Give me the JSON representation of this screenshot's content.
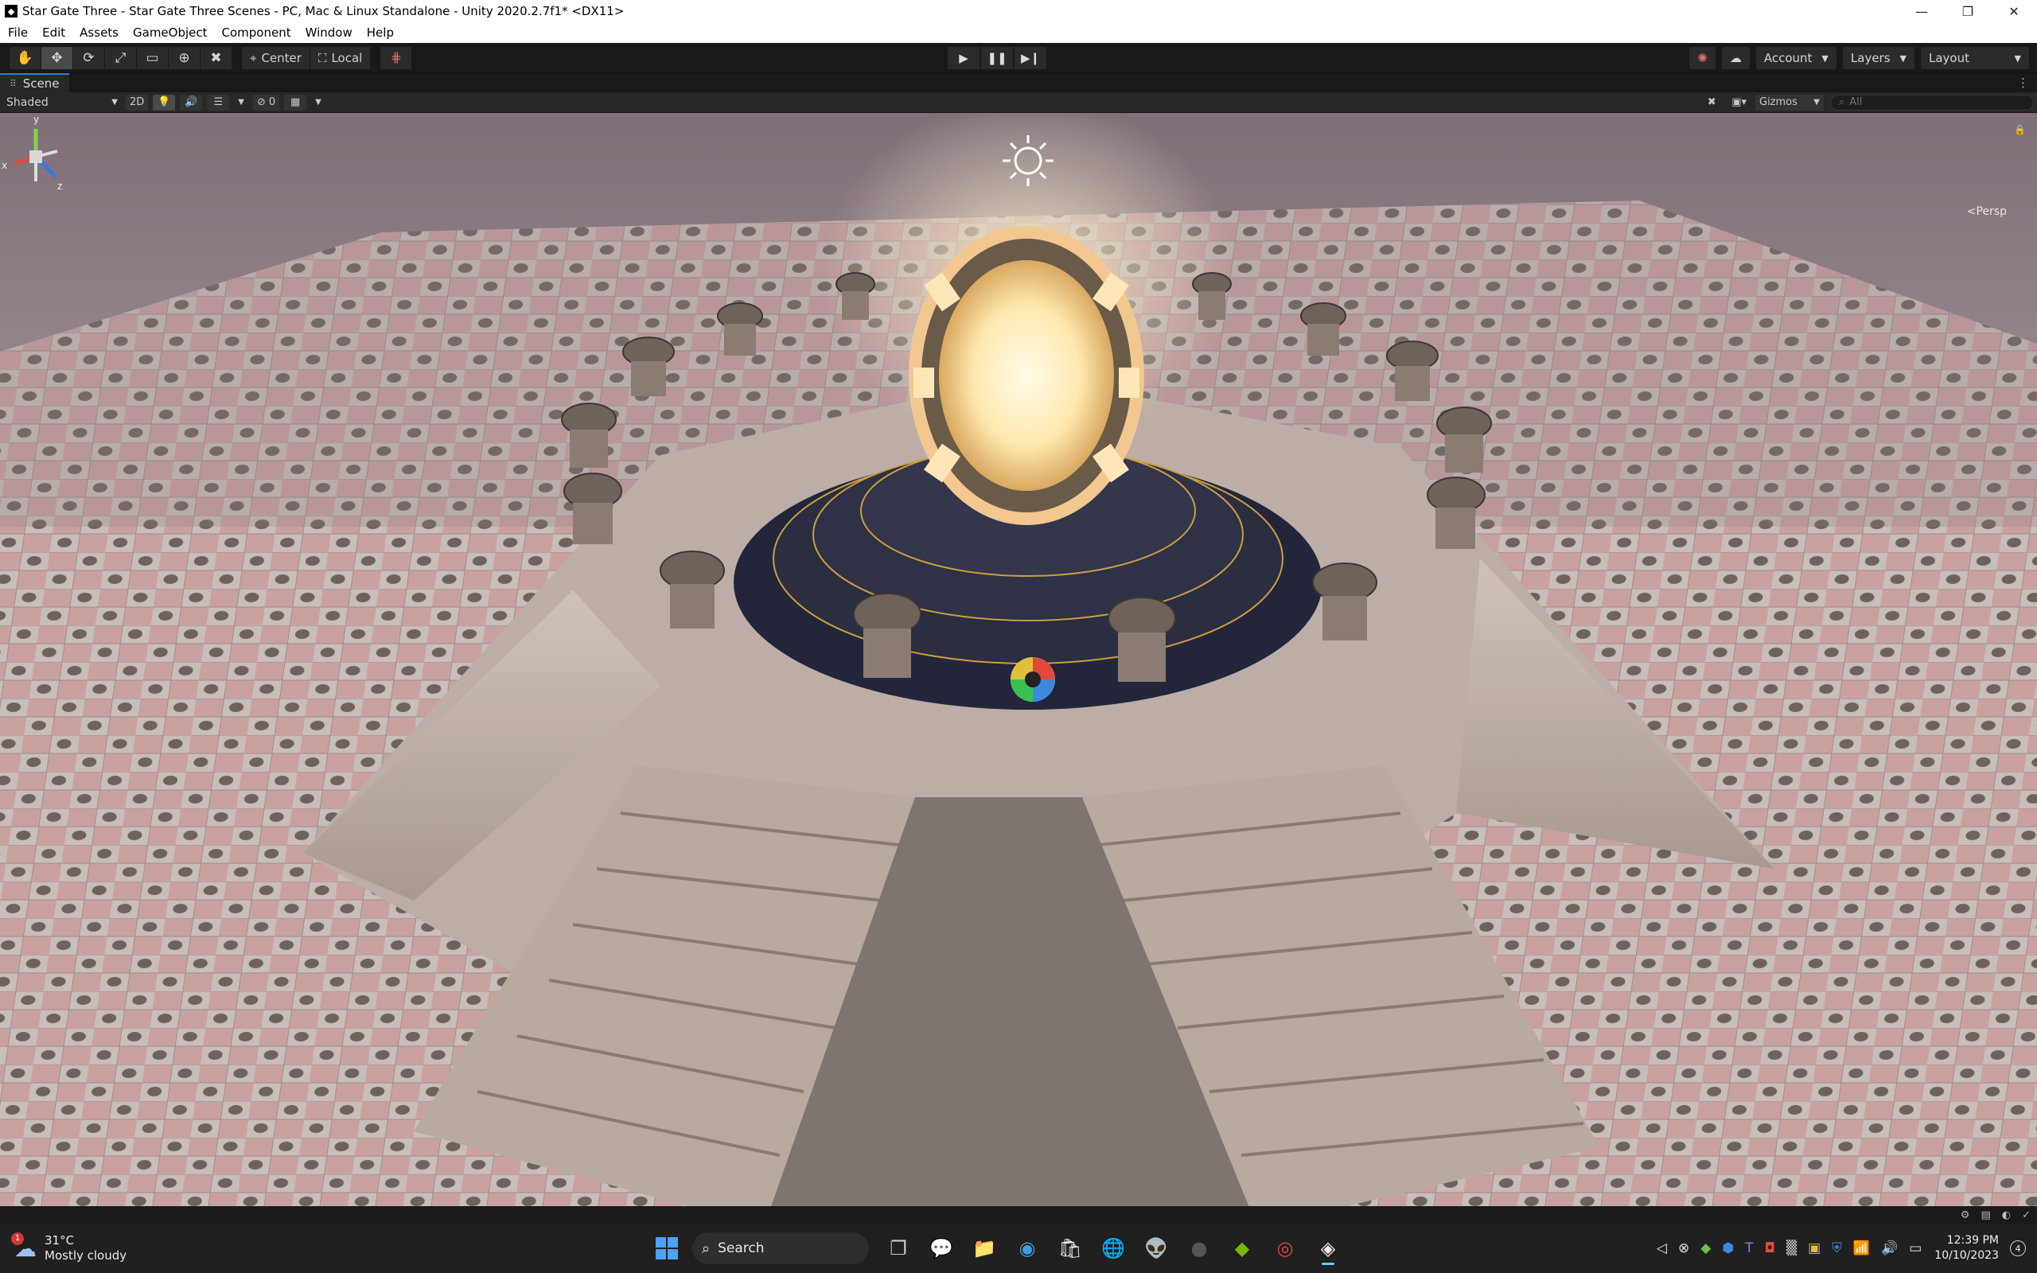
{
  "window": {
    "title": "Star Gate Three - Star Gate Three Scenes - PC, Mac & Linux Standalone - Unity 2020.2.7f1* <DX11>",
    "controls": {
      "minimize": "—",
      "restore": "❐",
      "close": "✕"
    }
  },
  "menu": [
    "File",
    "Edit",
    "Assets",
    "GameObject",
    "Component",
    "Window",
    "Help"
  ],
  "toolbar": {
    "tools": [
      {
        "name": "hand-tool",
        "glyph": "✋"
      },
      {
        "name": "move-tool",
        "glyph": "✥"
      },
      {
        "name": "rotate-tool",
        "glyph": "⟳"
      },
      {
        "name": "scale-tool",
        "glyph": "⤢"
      },
      {
        "name": "rect-tool",
        "glyph": "▭"
      },
      {
        "name": "transform-tool",
        "glyph": "⊕"
      },
      {
        "name": "custom-tool",
        "glyph": "✖"
      }
    ],
    "pivot_mode": "Center",
    "pivot_rotation": "Local",
    "play": "▶",
    "pause": "❚❚",
    "step": "▶❙",
    "account": "Account",
    "layers": "Layers",
    "layout": "Layout"
  },
  "scene_tab": {
    "label": "Scene"
  },
  "scene_toolbar": {
    "shading": "Shaded",
    "mode_2d": "2D",
    "hidden_count": "0",
    "gizmos": "Gizmos",
    "search_placeholder": "All"
  },
  "scene_view": {
    "projection": "<Persp",
    "axes": {
      "x": "x",
      "y": "y",
      "z": "z"
    }
  },
  "taskbar": {
    "weather_temp": "31°C",
    "weather_desc": "Mostly cloudy",
    "weather_badge": "1",
    "search": "Search",
    "time": "12:39 PM",
    "date": "10/10/2023",
    "notifications": "4"
  },
  "colors": {
    "accent": "#3a78d8",
    "portal_glow": "#ffe9b0",
    "tile_pink": "#c9a0a0",
    "tile_grey": "#c8bfbb",
    "stone": "#b9aca4",
    "platform": "#2b2d40"
  }
}
